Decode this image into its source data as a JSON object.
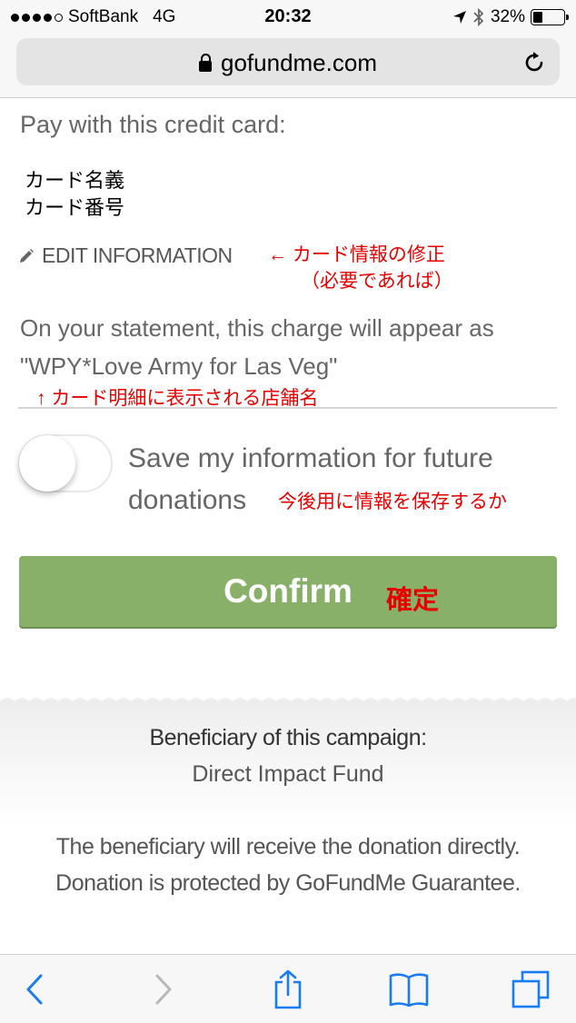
{
  "status_bar": {
    "carrier": "SoftBank",
    "network": "4G",
    "time": "20:32",
    "battery": "32%",
    "battery_level": 0.32,
    "icons": [
      "location-arrow-icon",
      "bluetooth-icon",
      "battery-icon"
    ]
  },
  "browser": {
    "url": "gofundme.com",
    "icons": [
      "lock-icon",
      "reload-icon"
    ]
  },
  "payment": {
    "title": "Pay with this credit card:",
    "card_holder_label": "カード名義",
    "card_number_label": "カード番号",
    "edit_label": "EDIT INFORMATION",
    "edit_note_line1": "← カード情報の修正",
    "edit_note_line2": "（必要であれば）",
    "statement_line1": "On your statement, this charge will appear as",
    "statement_line2": "\"WPY*Love Army for Las Veg\"",
    "statement_note": "↑ カード明細に表示される店舗名"
  },
  "save_option": {
    "label_line1": "Save my information for future",
    "label_line2": "donations",
    "note": "今後用に情報を保存するか",
    "toggle_on": false
  },
  "confirm": {
    "label": "Confirm",
    "note": "確定",
    "color": "#89b069"
  },
  "beneficiary": {
    "title": "Beneficiary of this campaign:",
    "name": "Direct Impact Fund",
    "note_line1": "The beneficiary will receive the donation directly.",
    "note_line2": "Donation is protected by GoFundMe Guarantee."
  },
  "toolbar": {
    "icons": [
      "back-icon",
      "forward-icon",
      "share-icon",
      "bookmarks-icon",
      "tabs-icon"
    ],
    "accent": "#1a7cf5"
  }
}
